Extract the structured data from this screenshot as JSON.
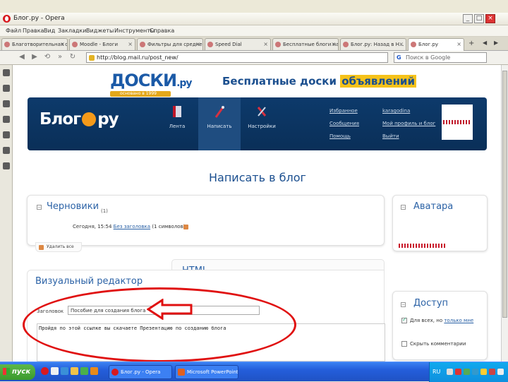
{
  "window": {
    "title": "Блог.ру - Opera"
  },
  "menu": [
    "Файл",
    "Правка",
    "Вид",
    "Закладки",
    "Виджеты",
    "Инструменты",
    "Справка"
  ],
  "tabs": [
    {
      "label": "Благотворительная орг..."
    },
    {
      "label": "Moodle - Блоги"
    },
    {
      "label": "Фильтры для средней ш..."
    },
    {
      "label": "Speed Dial"
    },
    {
      "label": "Бесплатные блоги на..."
    },
    {
      "label": "Блог.ру: Назад в Н..."
    },
    {
      "label": "Блог.ру",
      "active": true
    }
  ],
  "address": {
    "url": "http://blog.mail.ru/post_new/",
    "search_placeholder": "Поиск в Google"
  },
  "doski": {
    "logo": "ДОСКИ",
    "logo_suffix": ".ру",
    "since": "основано в 1999",
    "slogan_main": "Бесплатные доски",
    "slogan_highlight": "объявлений"
  },
  "blog_header": {
    "logo_left": "Блог",
    "logo_right": "ру",
    "nav": [
      {
        "label": "Лента",
        "icon": "book-icon"
      },
      {
        "label": "Написать",
        "icon": "pen-icon"
      },
      {
        "label": "Настройки",
        "icon": "tools-icon"
      }
    ],
    "links_left": [
      "Избранное",
      "Сообщения",
      "Помощь"
    ],
    "links_right": [
      "karagodina",
      "Мой профиль и блог",
      "Выйти"
    ]
  },
  "page_title": "Написать в блог",
  "drafts": {
    "title": "Черновики",
    "count": "(1)",
    "date": "Сегодня, 15:54",
    "link": "Без заголовка",
    "meta": "(1 символов)",
    "delete_all": "Удалить все"
  },
  "avatar_box": {
    "title": "Аватара"
  },
  "editor": {
    "tab_visual": "Визуальный редактор",
    "tab_html": "HTML",
    "title_label": "Заголовок",
    "title_value": "Пособие для создания блога",
    "body_text": "Пройдя по этой ссылке вы скачаете Презентацию по созданию блога"
  },
  "access_box": {
    "title": "Доступ",
    "option1": "Для всех, но",
    "option1_link": "только мне",
    "option2": "Скрыть комментарии"
  },
  "taskbar": {
    "start": "пуск",
    "tasks": [
      "Блог.ру - Opera",
      "Microsoft PowerPoint..."
    ],
    "lang": "RU"
  },
  "colors": {
    "brand_blue": "#0d3a6b",
    "accent_orange": "#f59a1a",
    "annotation_red": "#e01010"
  }
}
